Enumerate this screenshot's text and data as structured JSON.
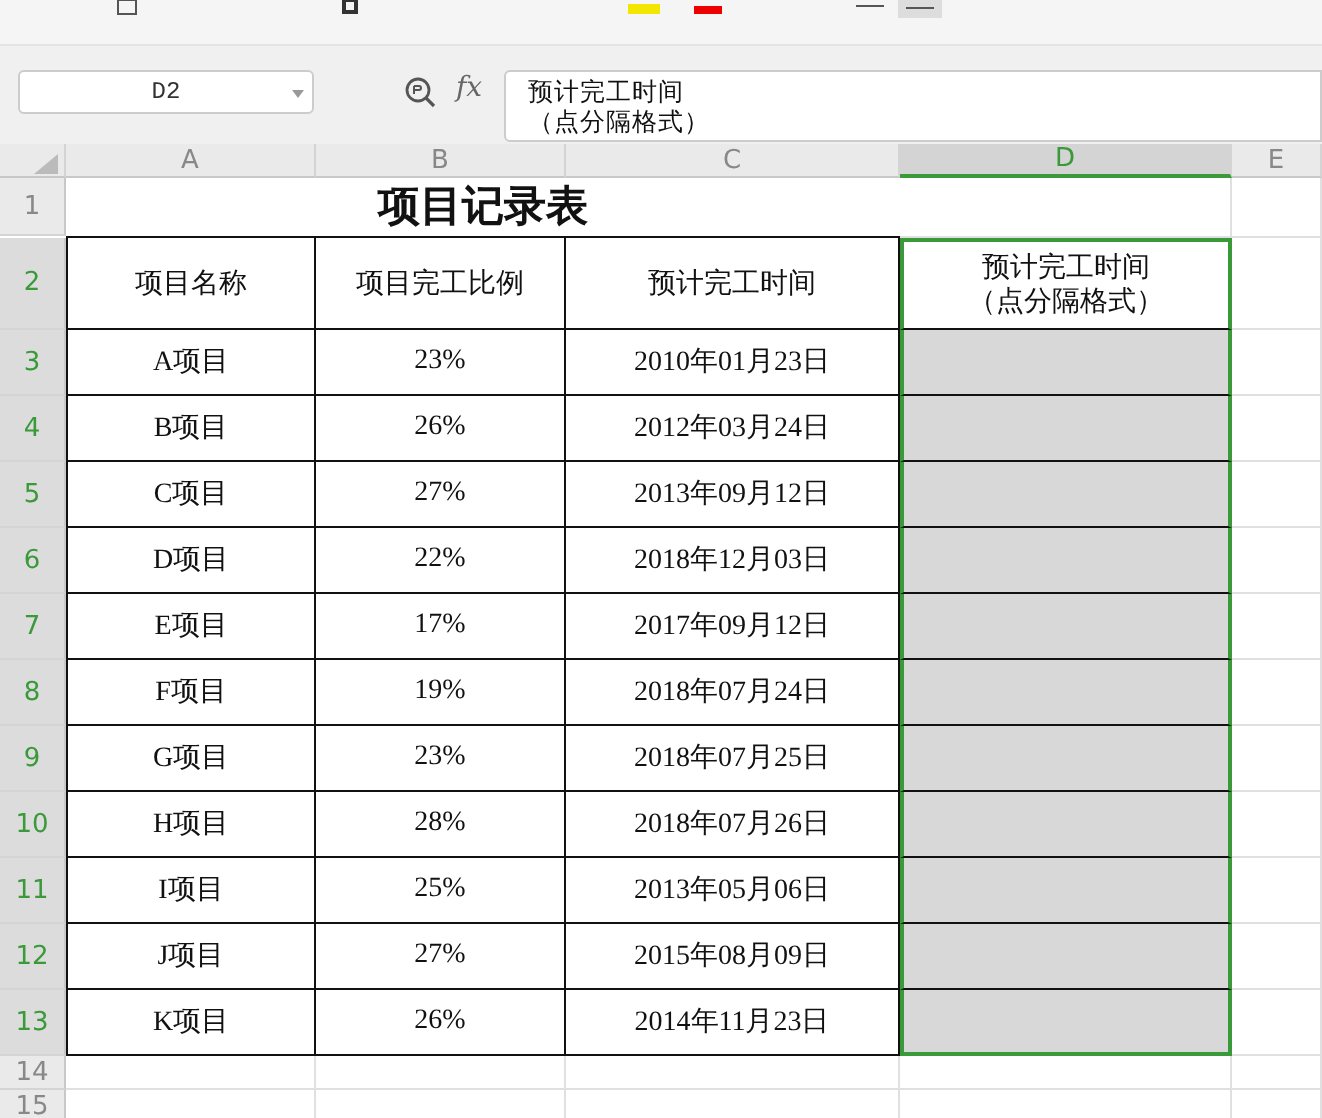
{
  "name_box": {
    "value": "D2"
  },
  "function_label": "fx",
  "formula": {
    "lines": [
      "预计完工时间",
      "（点分隔格式）"
    ]
  },
  "columns": [
    {
      "label": "A",
      "selected": false
    },
    {
      "label": "B",
      "selected": false
    },
    {
      "label": "C",
      "selected": false
    },
    {
      "label": "D",
      "selected": true
    },
    {
      "label": "E",
      "selected": false
    }
  ],
  "row_headers": [
    {
      "label": "1",
      "selected": false
    },
    {
      "label": "2",
      "selected": true
    },
    {
      "label": "3",
      "selected": true
    },
    {
      "label": "4",
      "selected": true
    },
    {
      "label": "5",
      "selected": true
    },
    {
      "label": "6",
      "selected": true
    },
    {
      "label": "7",
      "selected": true
    },
    {
      "label": "8",
      "selected": true
    },
    {
      "label": "9",
      "selected": true
    },
    {
      "label": "10",
      "selected": true
    },
    {
      "label": "11",
      "selected": true
    },
    {
      "label": "12",
      "selected": true
    },
    {
      "label": "13",
      "selected": true
    },
    {
      "label": "14",
      "selected": false
    },
    {
      "label": "15",
      "selected": false
    }
  ],
  "title": "项目记录表",
  "headers": [
    "项目名称",
    "项目完工比例",
    "预计完工时间"
  ],
  "selected_header": {
    "lines": [
      "预计完工时间",
      "（点分隔格式）"
    ]
  },
  "records": [
    [
      "A项目",
      "23%",
      "2010年01月23日"
    ],
    [
      "B项目",
      "26%",
      "2012年03月24日"
    ],
    [
      "C项目",
      "27%",
      "2013年09月12日"
    ],
    [
      "D项目",
      "22%",
      "2018年12月03日"
    ],
    [
      "E项目",
      "17%",
      "2017年09月12日"
    ],
    [
      "F项目",
      "19%",
      "2018年07月24日"
    ],
    [
      "G项目",
      "23%",
      "2018年07月25日"
    ],
    [
      "H项目",
      "28%",
      "2018年07月26日"
    ],
    [
      "I项目",
      "25%",
      "2013年05月06日"
    ],
    [
      "J项目",
      "27%",
      "2015年08月09日"
    ],
    [
      "K项目",
      "26%",
      "2014年11月23日"
    ]
  ]
}
